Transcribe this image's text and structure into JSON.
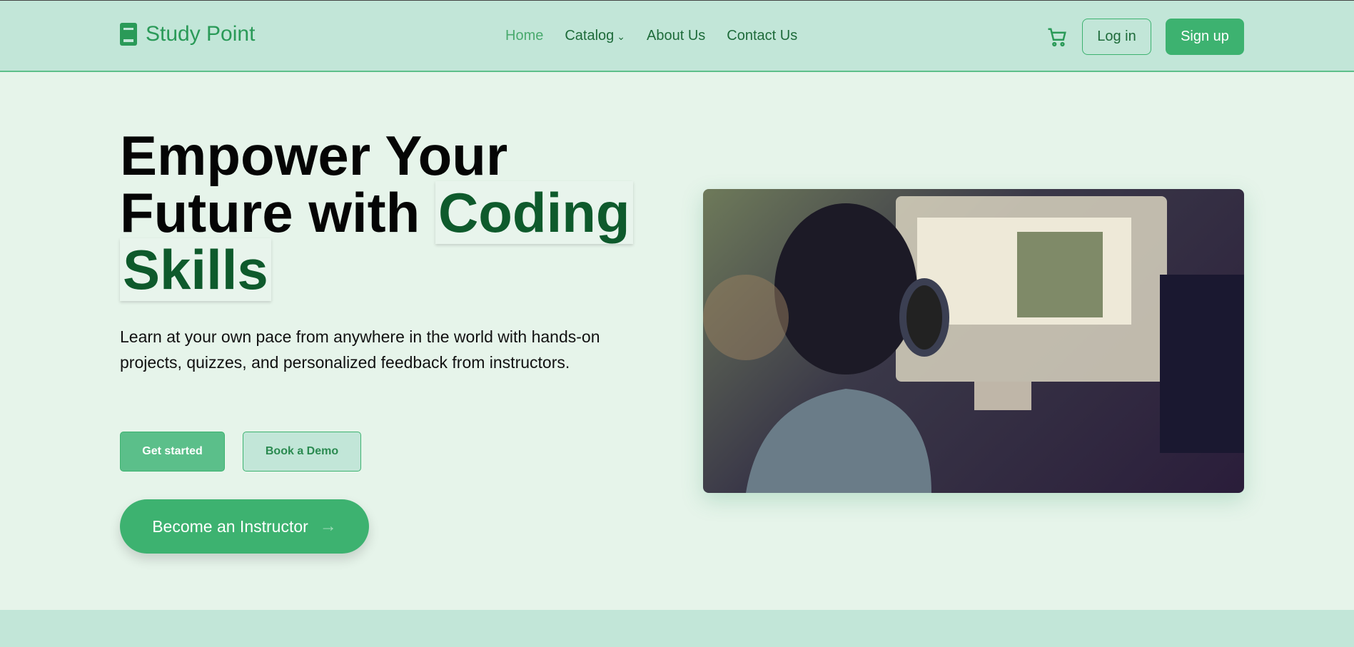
{
  "header": {
    "brand": "Study Point",
    "nav": [
      {
        "label": "Home"
      },
      {
        "label": "Catalog"
      },
      {
        "label": "About Us"
      },
      {
        "label": "Contact Us"
      }
    ],
    "login": "Log in",
    "signup": "Sign up"
  },
  "hero": {
    "title_part1": "Empower Your Future with",
    "title_highlight1": "Coding",
    "title_highlight2": "Skills",
    "description": "Learn at your own pace from anywhere in the world with hands-on projects, quizzes, and personalized feedback from instructors.",
    "get_started": "Get started",
    "book_demo": "Book a Demo",
    "become_instructor": "Become an Instructor"
  },
  "colors": {
    "accent": "#3db270",
    "header_bg": "#c2e6d8",
    "page_bg": "#e6f4ea",
    "highlight_text": "#0e5a2c"
  }
}
